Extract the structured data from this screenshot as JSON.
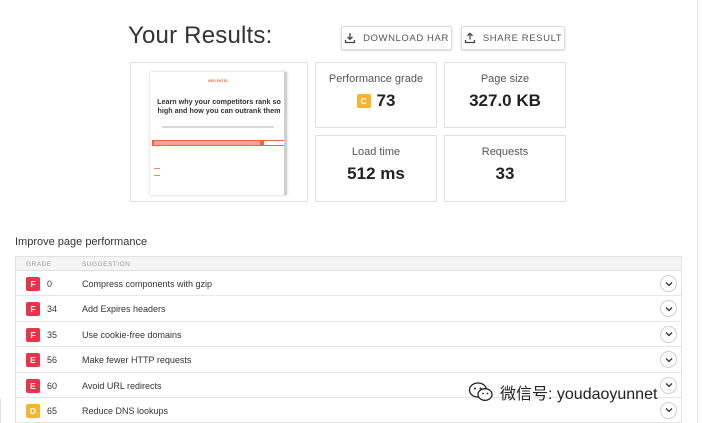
{
  "header": {
    "title": "Your Results:",
    "download_label": "DOWNLOAD HAR",
    "share_label": "SHARE RESULT"
  },
  "preview": {
    "logo_text": "NEILPATEL",
    "heading": "Learn why your competitors rank so high and how you can outrank them"
  },
  "metrics": {
    "performance": {
      "label": "Performance grade",
      "grade": "C",
      "value": "73",
      "grade_color": "#f5b52c"
    },
    "page_size": {
      "label": "Page size",
      "value": "327.0 KB"
    },
    "load_time": {
      "label": "Load time",
      "value": "512 ms"
    },
    "requests": {
      "label": "Requests",
      "value": "33"
    }
  },
  "improve": {
    "title": "Improve page performance",
    "col_grade": "GRADE",
    "col_suggestion": "SUGGESTION",
    "rows": [
      {
        "grade": "F",
        "score": "0",
        "suggestion": "Compress components with gzip",
        "color": "#e8334a"
      },
      {
        "grade": "F",
        "score": "34",
        "suggestion": "Add Expires headers",
        "color": "#e8334a"
      },
      {
        "grade": "F",
        "score": "35",
        "suggestion": "Use cookie-free domains",
        "color": "#e8334a"
      },
      {
        "grade": "E",
        "score": "56",
        "suggestion": "Make fewer HTTP requests",
        "color": "#e8334a"
      },
      {
        "grade": "E",
        "score": "60",
        "suggestion": "Avoid URL redirects",
        "color": "#e8334a"
      },
      {
        "grade": "D",
        "score": "65",
        "suggestion": "Reduce DNS lookups",
        "color": "#f5b52c"
      }
    ]
  },
  "watermark": {
    "text": "微信号: youdaoyunnet",
    "icon": "wechat-icon"
  }
}
